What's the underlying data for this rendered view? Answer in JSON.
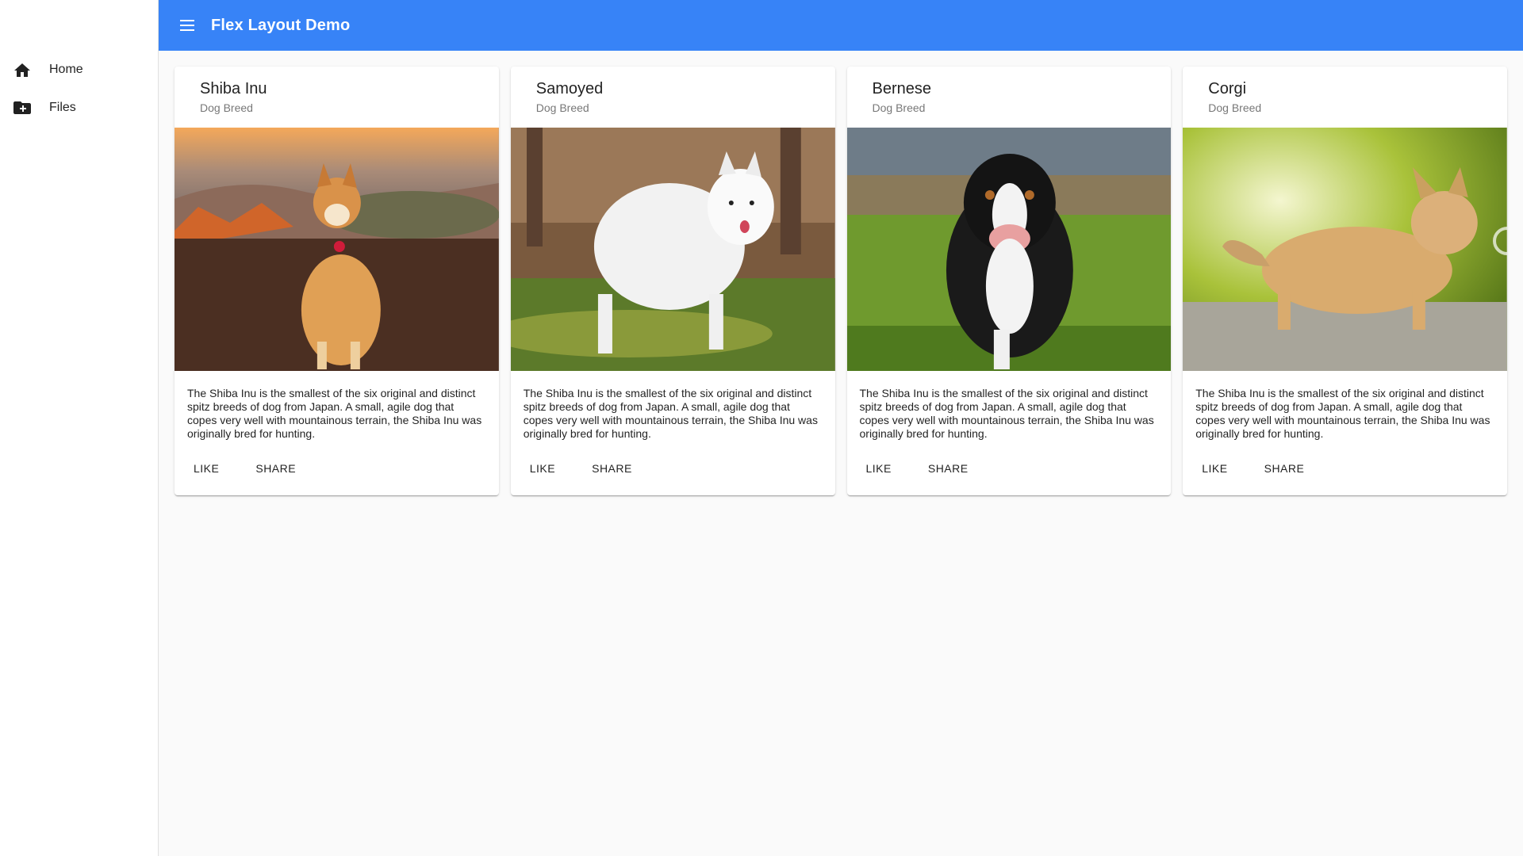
{
  "sidebar": {
    "items": [
      {
        "label": "Home",
        "icon": "home-icon"
      },
      {
        "label": "Files",
        "icon": "folder-add-icon"
      }
    ]
  },
  "toolbar": {
    "title": "Flex Layout Demo",
    "menu_icon": "menu-icon",
    "color": "#3783f7"
  },
  "cards": [
    {
      "title": "Shiba Inu",
      "subtitle": "Dog Breed",
      "description": "The Shiba Inu is the smallest of the six original and distinct spitz breeds of dog from Japan. A small, agile dog that copes very well with mountainous terrain, the Shiba Inu was originally bred for hunting.",
      "like_label": "LIKE",
      "share_label": "SHARE"
    },
    {
      "title": "Samoyed",
      "subtitle": "Dog Breed",
      "description": "The Shiba Inu is the smallest of the six original and distinct spitz breeds of dog from Japan. A small, agile dog that copes very well with mountainous terrain, the Shiba Inu was originally bred for hunting.",
      "like_label": "LIKE",
      "share_label": "SHARE"
    },
    {
      "title": "Bernese",
      "subtitle": "Dog Breed",
      "description": "The Shiba Inu is the smallest of the six original and distinct spitz breeds of dog from Japan. A small, agile dog that copes very well with mountainous terrain, the Shiba Inu was originally bred for hunting.",
      "like_label": "LIKE",
      "share_label": "SHARE"
    },
    {
      "title": "Corgi",
      "subtitle": "Dog Breed",
      "description": "The Shiba Inu is the smallest of the six original and distinct spitz breeds of dog from Japan. A small, agile dog that copes very well with mountainous terrain, the Shiba Inu was originally bred for hunting.",
      "like_label": "LIKE",
      "share_label": "SHARE"
    }
  ]
}
